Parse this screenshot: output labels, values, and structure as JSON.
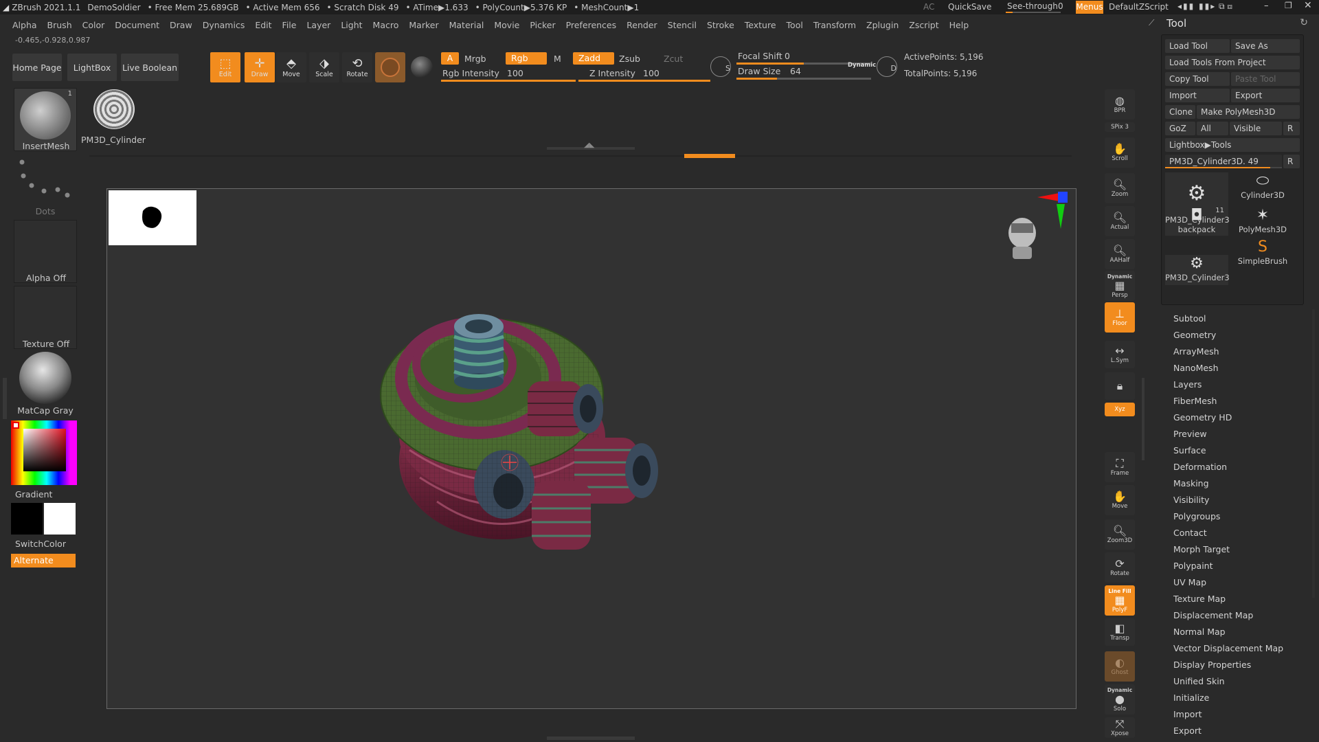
{
  "titlebar": {
    "app": "ZBrush 2021.1.1",
    "project": "DemoSoldier",
    "free_mem": "• Free Mem 25.689GB",
    "active_mem": "• Active Mem 656",
    "scratch": "• Scratch Disk 49",
    "atime": "• ATime▶1.633",
    "polycount": "• PolyCount▶5.376 KP",
    "meshcount": "• MeshCount▶1",
    "ac": "AC",
    "quicksave": "QuickSave",
    "seethrough": "See-through",
    "seethrough_value": "0",
    "menus": "Menus",
    "script": "DefaultZScript"
  },
  "menubar": [
    "Alpha",
    "Brush",
    "Color",
    "Document",
    "Draw",
    "Dynamics",
    "Edit",
    "File",
    "Layer",
    "Light",
    "Macro",
    "Marker",
    "Material",
    "Movie",
    "Picker",
    "Preferences",
    "Render",
    "Stencil",
    "Stroke",
    "Texture",
    "Tool",
    "Transform",
    "Zplugin",
    "Zscript",
    "Help"
  ],
  "coords": "-0.465,-0.928,0.987",
  "toolbar": {
    "home": "Home Page",
    "lightbox": "LightBox",
    "live_boolean": "Live Boolean",
    "edit": "Edit",
    "draw": "Draw",
    "move": "Move",
    "scale": "Scale",
    "rotate": "Rotate",
    "a": "A",
    "mrgb": "Mrgb",
    "rgb": "Rgb",
    "m": "M",
    "zadd": "Zadd",
    "zsub": "Zsub",
    "zcut": "Zcut",
    "rgb_intensity_label": "Rgb Intensity",
    "rgb_intensity": "100",
    "z_intensity_label": "Z Intensity",
    "z_intensity": "100",
    "focal_shift_label": "Focal Shift",
    "focal_shift": "0",
    "draw_size_label": "Draw Size",
    "draw_size": "64",
    "dynamic": "Dynamic",
    "active_points": "ActivePoints: 5,196",
    "total_points": "TotalPoints: 5,196",
    "s": "S",
    "d": "D",
    "rgb_intensity_level": 1.0,
    "z_intensity_level": 1.0,
    "focal_shift_level": 0.5,
    "draw_size_level": 0.3
  },
  "lightbox_items": [
    {
      "label": "InsertMesh",
      "badge": "1"
    },
    {
      "label": "PM3D_Cylinder"
    }
  ],
  "left_panel": {
    "dots": "Dots",
    "alpha": "Alpha Off",
    "texture": "Texture Off",
    "matcap": "MatCap Gray",
    "gradient": "Gradient",
    "switchcolor": "SwitchColor",
    "alternate": "Alternate"
  },
  "right_strip": [
    {
      "label": "BPR",
      "icon": "sphere-icon"
    },
    {
      "label": "SPix 3",
      "icon": "slider-icon"
    },
    {
      "label": "Scroll",
      "icon": "hand-icon"
    },
    {
      "label": "Zoom",
      "icon": "zoom-icon"
    },
    {
      "label": "Actual",
      "icon": "zoom-icon"
    },
    {
      "label": "AAHalf",
      "icon": "zoom-icon"
    },
    {
      "label": "Persp",
      "icon": "grid-icon",
      "top": "Dynamic"
    },
    {
      "label": "Floor",
      "icon": "floor-icon",
      "active": true
    },
    {
      "label": "L.Sym",
      "icon": "sym-icon"
    },
    {
      "label": "",
      "icon": "lock-icon"
    },
    {
      "label": "Xyz",
      "icon": "xyz-icon",
      "active": true
    },
    {
      "label": "Frame",
      "icon": "frame-icon"
    },
    {
      "label": "Move",
      "icon": "hand-icon"
    },
    {
      "label": "Zoom3D",
      "icon": "zoom-icon"
    },
    {
      "label": "Rotate",
      "icon": "rotate-icon"
    },
    {
      "label": "PolyF",
      "icon": "grid-icon",
      "top": "Line Fill",
      "active": true
    },
    {
      "label": "Transp",
      "icon": "transp-icon"
    },
    {
      "label": "Ghost",
      "icon": "ghost-icon",
      "dim": true
    },
    {
      "label": "Solo",
      "icon": "solo-icon",
      "top": "Dynamic"
    },
    {
      "label": "Xpose",
      "icon": "xpose-icon"
    }
  ],
  "tool_panel": {
    "title": "Tool",
    "load_tool": "Load Tool",
    "save_as": "Save As",
    "load_from_project": "Load Tools From Project",
    "copy_tool": "Copy Tool",
    "paste_tool": "Paste Tool",
    "import": "Import",
    "export": "Export",
    "clone": "Clone",
    "make_polymesh": "Make PolyMesh3D",
    "goz": "GoZ",
    "all": "All",
    "visible": "Visible",
    "r": "R",
    "lightbox_tools": "Lightbox▶Tools",
    "current_tool": "PM3D_Cylinder3D. 49",
    "current_tool_level": 0.9,
    "thumbs": [
      {
        "label": "PM3D_Cylinder3",
        "icon": "mesh-icon"
      },
      {
        "label": "Cylinder3D",
        "icon": "cylinder-icon"
      },
      {
        "label": "PolyMesh3D",
        "icon": "star-icon"
      },
      {
        "label": "backpack",
        "icon": "backpack-icon",
        "badge": "11"
      },
      {
        "label": "SimpleBrush",
        "icon": "s-icon"
      },
      {
        "label": "PM3D_Cylinder3",
        "icon": "mesh-icon"
      }
    ]
  },
  "tool_menu": [
    "Subtool",
    "Geometry",
    "ArrayMesh",
    "NanoMesh",
    "Layers",
    "FiberMesh",
    "Geometry HD",
    "Preview",
    "Surface",
    "Deformation",
    "Masking",
    "Visibility",
    "Polygroups",
    "Contact",
    "Morph Target",
    "Polypaint",
    "UV Map",
    "Texture Map",
    "Displacement Map",
    "Normal Map",
    "Vector Displacement Map",
    "Display Properties",
    "Unified Skin",
    "Initialize",
    "Import",
    "Export"
  ],
  "colors": {
    "accent": "#f28c1e",
    "bg": "#2a2a2a",
    "viewport": "#323232"
  }
}
